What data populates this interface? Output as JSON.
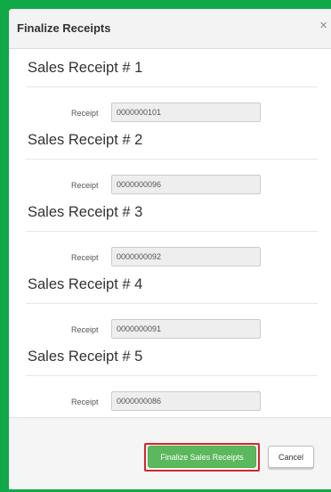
{
  "dialog": {
    "title": "Finalize Receipts",
    "close_icon": "close-icon"
  },
  "receipts": [
    {
      "heading": "Sales Receipt # 1",
      "label": "Receipt",
      "value": "0000000101"
    },
    {
      "heading": "Sales Receipt # 2",
      "label": "Receipt",
      "value": "0000000096"
    },
    {
      "heading": "Sales Receipt # 3",
      "label": "Receipt",
      "value": "0000000092"
    },
    {
      "heading": "Sales Receipt # 4",
      "label": "Receipt",
      "value": "0000000091"
    },
    {
      "heading": "Sales Receipt # 5",
      "label": "Receipt",
      "value": "0000000086"
    }
  ],
  "footer": {
    "finalize_label": "Finalize Sales Receipts",
    "cancel_label": "Cancel"
  },
  "colors": {
    "background": "#11a847",
    "primary_button": "#5cb85c",
    "highlight_outline": "#d8242c"
  }
}
